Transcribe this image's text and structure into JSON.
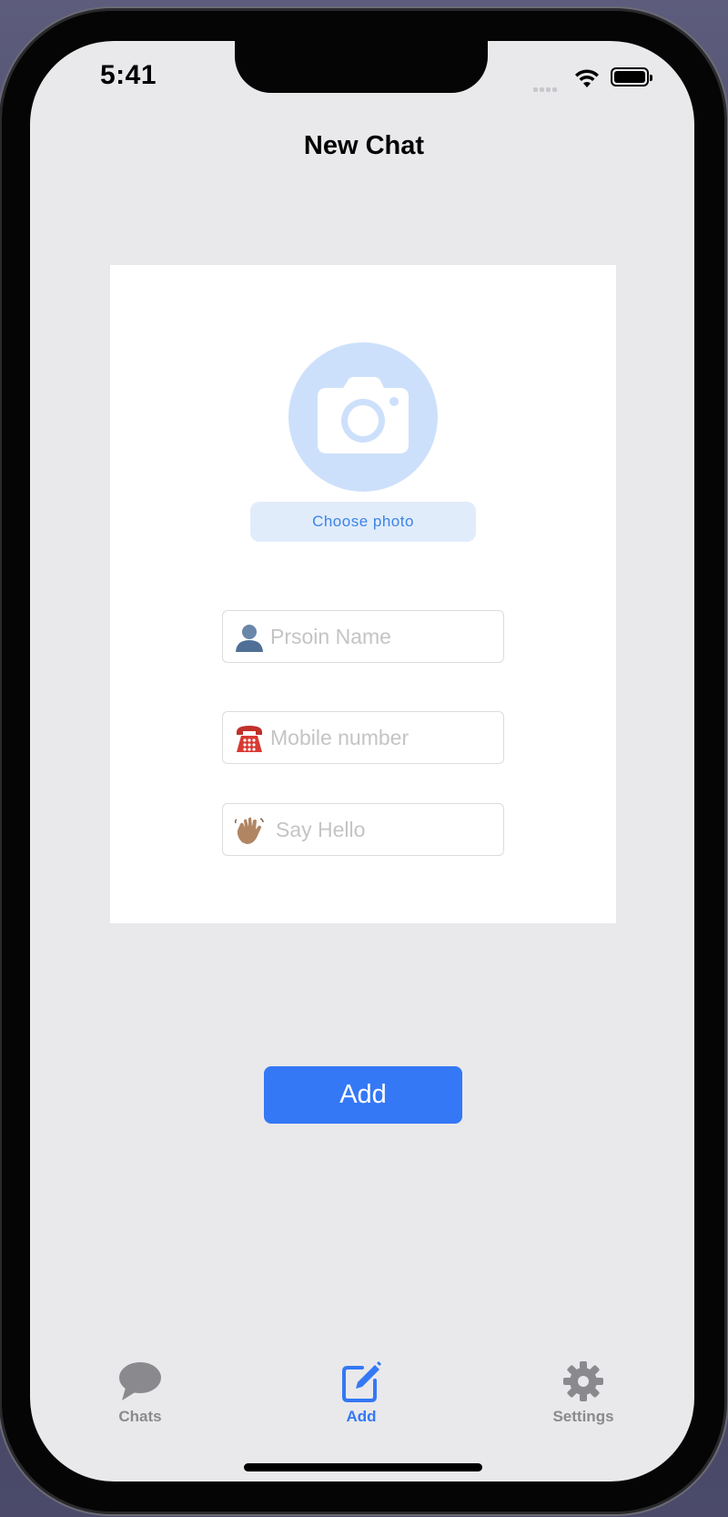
{
  "status_bar": {
    "time": "5:41"
  },
  "nav": {
    "title": "New Chat"
  },
  "photo": {
    "icon": "camera-icon",
    "choose_label": "Choose photo"
  },
  "form": {
    "name": {
      "icon": "bust-in-silhouette-icon",
      "placeholder": "Prsoin Name",
      "value": ""
    },
    "mobile": {
      "icon": "telephone-icon",
      "placeholder": "Mobile number",
      "value": ""
    },
    "message": {
      "icon": "waving-hand-icon",
      "placeholder": "Say Hello",
      "value": ""
    }
  },
  "actions": {
    "add_label": "Add"
  },
  "tabs": [
    {
      "label": "Chats",
      "icon": "speech-bubble-icon",
      "active": false
    },
    {
      "label": "Add",
      "icon": "compose-icon",
      "active": true
    },
    {
      "label": "Settings",
      "icon": "gear-icon",
      "active": false
    }
  ],
  "colors": {
    "accent": "#3478f6",
    "photo_circle": "#cde0fb",
    "choose_button_bg": "#e1ecfb",
    "background": "#e9e9eb",
    "tab_inactive": "#8a8a8e"
  }
}
